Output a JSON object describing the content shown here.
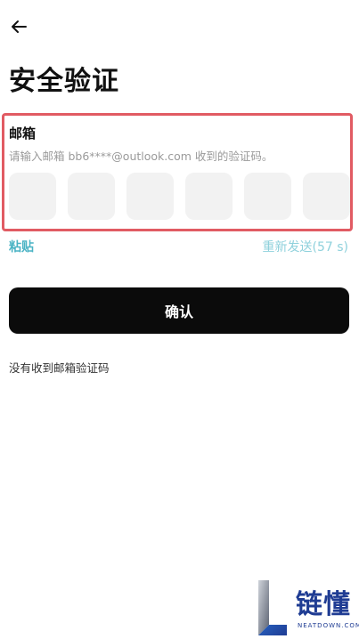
{
  "header": {
    "back_icon": "arrow-left-icon"
  },
  "page": {
    "title": "安全验证"
  },
  "verification": {
    "label": "邮箱",
    "hint": "请输入邮箱 bb6****@outlook.com 收到的验证码。",
    "code_digits": [
      "",
      "",
      "",
      "",
      "",
      ""
    ],
    "paste_label": "粘贴",
    "resend_label": "重新发送(57 s)"
  },
  "actions": {
    "confirm_label": "确认",
    "no_code_label": "没有收到邮箱验证码"
  },
  "watermark": {
    "text": "链懂",
    "sub": "NEATDOWN.COM"
  },
  "colors": {
    "accent": "#4ab3c4",
    "highlight": "#e15b63",
    "button_bg": "#0b0b0b",
    "watermark": "#1f3c93"
  }
}
